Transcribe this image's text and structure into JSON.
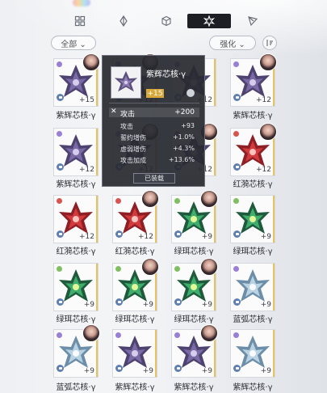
{
  "colors": {
    "accent": "#1d1f24",
    "level_gold": "#d6a93a",
    "rarity": "#e8c25a",
    "lock": "#5f7fb0"
  },
  "tabs": [
    {
      "icon": "grid-icon",
      "active": false
    },
    {
      "icon": "crystal-icon",
      "active": false
    },
    {
      "icon": "cube-icon",
      "active": false
    },
    {
      "icon": "star-cluster-icon",
      "active": true
    },
    {
      "icon": "triangle-icon",
      "active": false
    }
  ],
  "filters": {
    "left": "全部 ⌄",
    "right": "强化 ⌄"
  },
  "popup": {
    "title": "紫辉芯核·γ",
    "level": "+15",
    "stats": [
      {
        "label": "攻击",
        "value": "+200",
        "main": true
      },
      {
        "label": "攻击",
        "value": "+93",
        "main": false
      },
      {
        "label": "誓约增伤",
        "value": "+1.0%",
        "main": false
      },
      {
        "label": "虚弱增伤",
        "value": "+4.3%",
        "main": false
      },
      {
        "label": "攻击加成",
        "value": "+13.6%",
        "main": false
      }
    ],
    "unequip_label": "已装载"
  },
  "items": [
    {
      "name": "紫辉芯核·γ",
      "level": "+15",
      "gem": "purple",
      "avatar": true
    },
    {
      "name": "",
      "level": "+12",
      "gem": "purple",
      "avatar": true
    },
    {
      "name": "",
      "level": "+12",
      "gem": "purple",
      "avatar": false
    },
    {
      "name": "紫辉芯核·γ",
      "level": "+12",
      "gem": "purple",
      "avatar": true
    },
    {
      "name": "紫辉芯核·γ",
      "level": "+12",
      "gem": "purple",
      "avatar": false
    },
    {
      "name": "",
      "level": "+12",
      "gem": "purple",
      "avatar": true
    },
    {
      "name": "",
      "level": "+12",
      "gem": "purple",
      "avatar": true
    },
    {
      "name": "红漪芯核·γ",
      "level": "+12",
      "gem": "red",
      "avatar": true
    },
    {
      "name": "红漪芯核·γ",
      "level": "+12",
      "gem": "red",
      "avatar": false
    },
    {
      "name": "红漪芯核·γ",
      "level": "+12",
      "gem": "red",
      "avatar": true
    },
    {
      "name": "绿珥芯核·γ",
      "level": "+9",
      "gem": "green",
      "avatar": true
    },
    {
      "name": "绿珥芯核·γ",
      "level": "+9",
      "gem": "green",
      "avatar": false
    },
    {
      "name": "绿珥芯核·γ",
      "level": "+9",
      "gem": "green",
      "avatar": false
    },
    {
      "name": "绿珥芯核·γ",
      "level": "+9",
      "gem": "green",
      "avatar": true
    },
    {
      "name": "绿珥芯核·γ",
      "level": "+9",
      "gem": "green",
      "avatar": true
    },
    {
      "name": "蓝弧芯核·γ",
      "level": "+9",
      "gem": "blue",
      "avatar": false
    },
    {
      "name": "蓝弧芯核·γ",
      "level": "+9",
      "gem": "blue",
      "avatar": true
    },
    {
      "name": "紫辉芯核·γ",
      "level": "+9",
      "gem": "purple",
      "avatar": false
    },
    {
      "name": "紫辉芯核·γ",
      "level": "+9",
      "gem": "purple",
      "avatar": true
    },
    {
      "name": "紫辉芯核·γ",
      "level": "+9",
      "gem": "blue",
      "avatar": false
    }
  ]
}
